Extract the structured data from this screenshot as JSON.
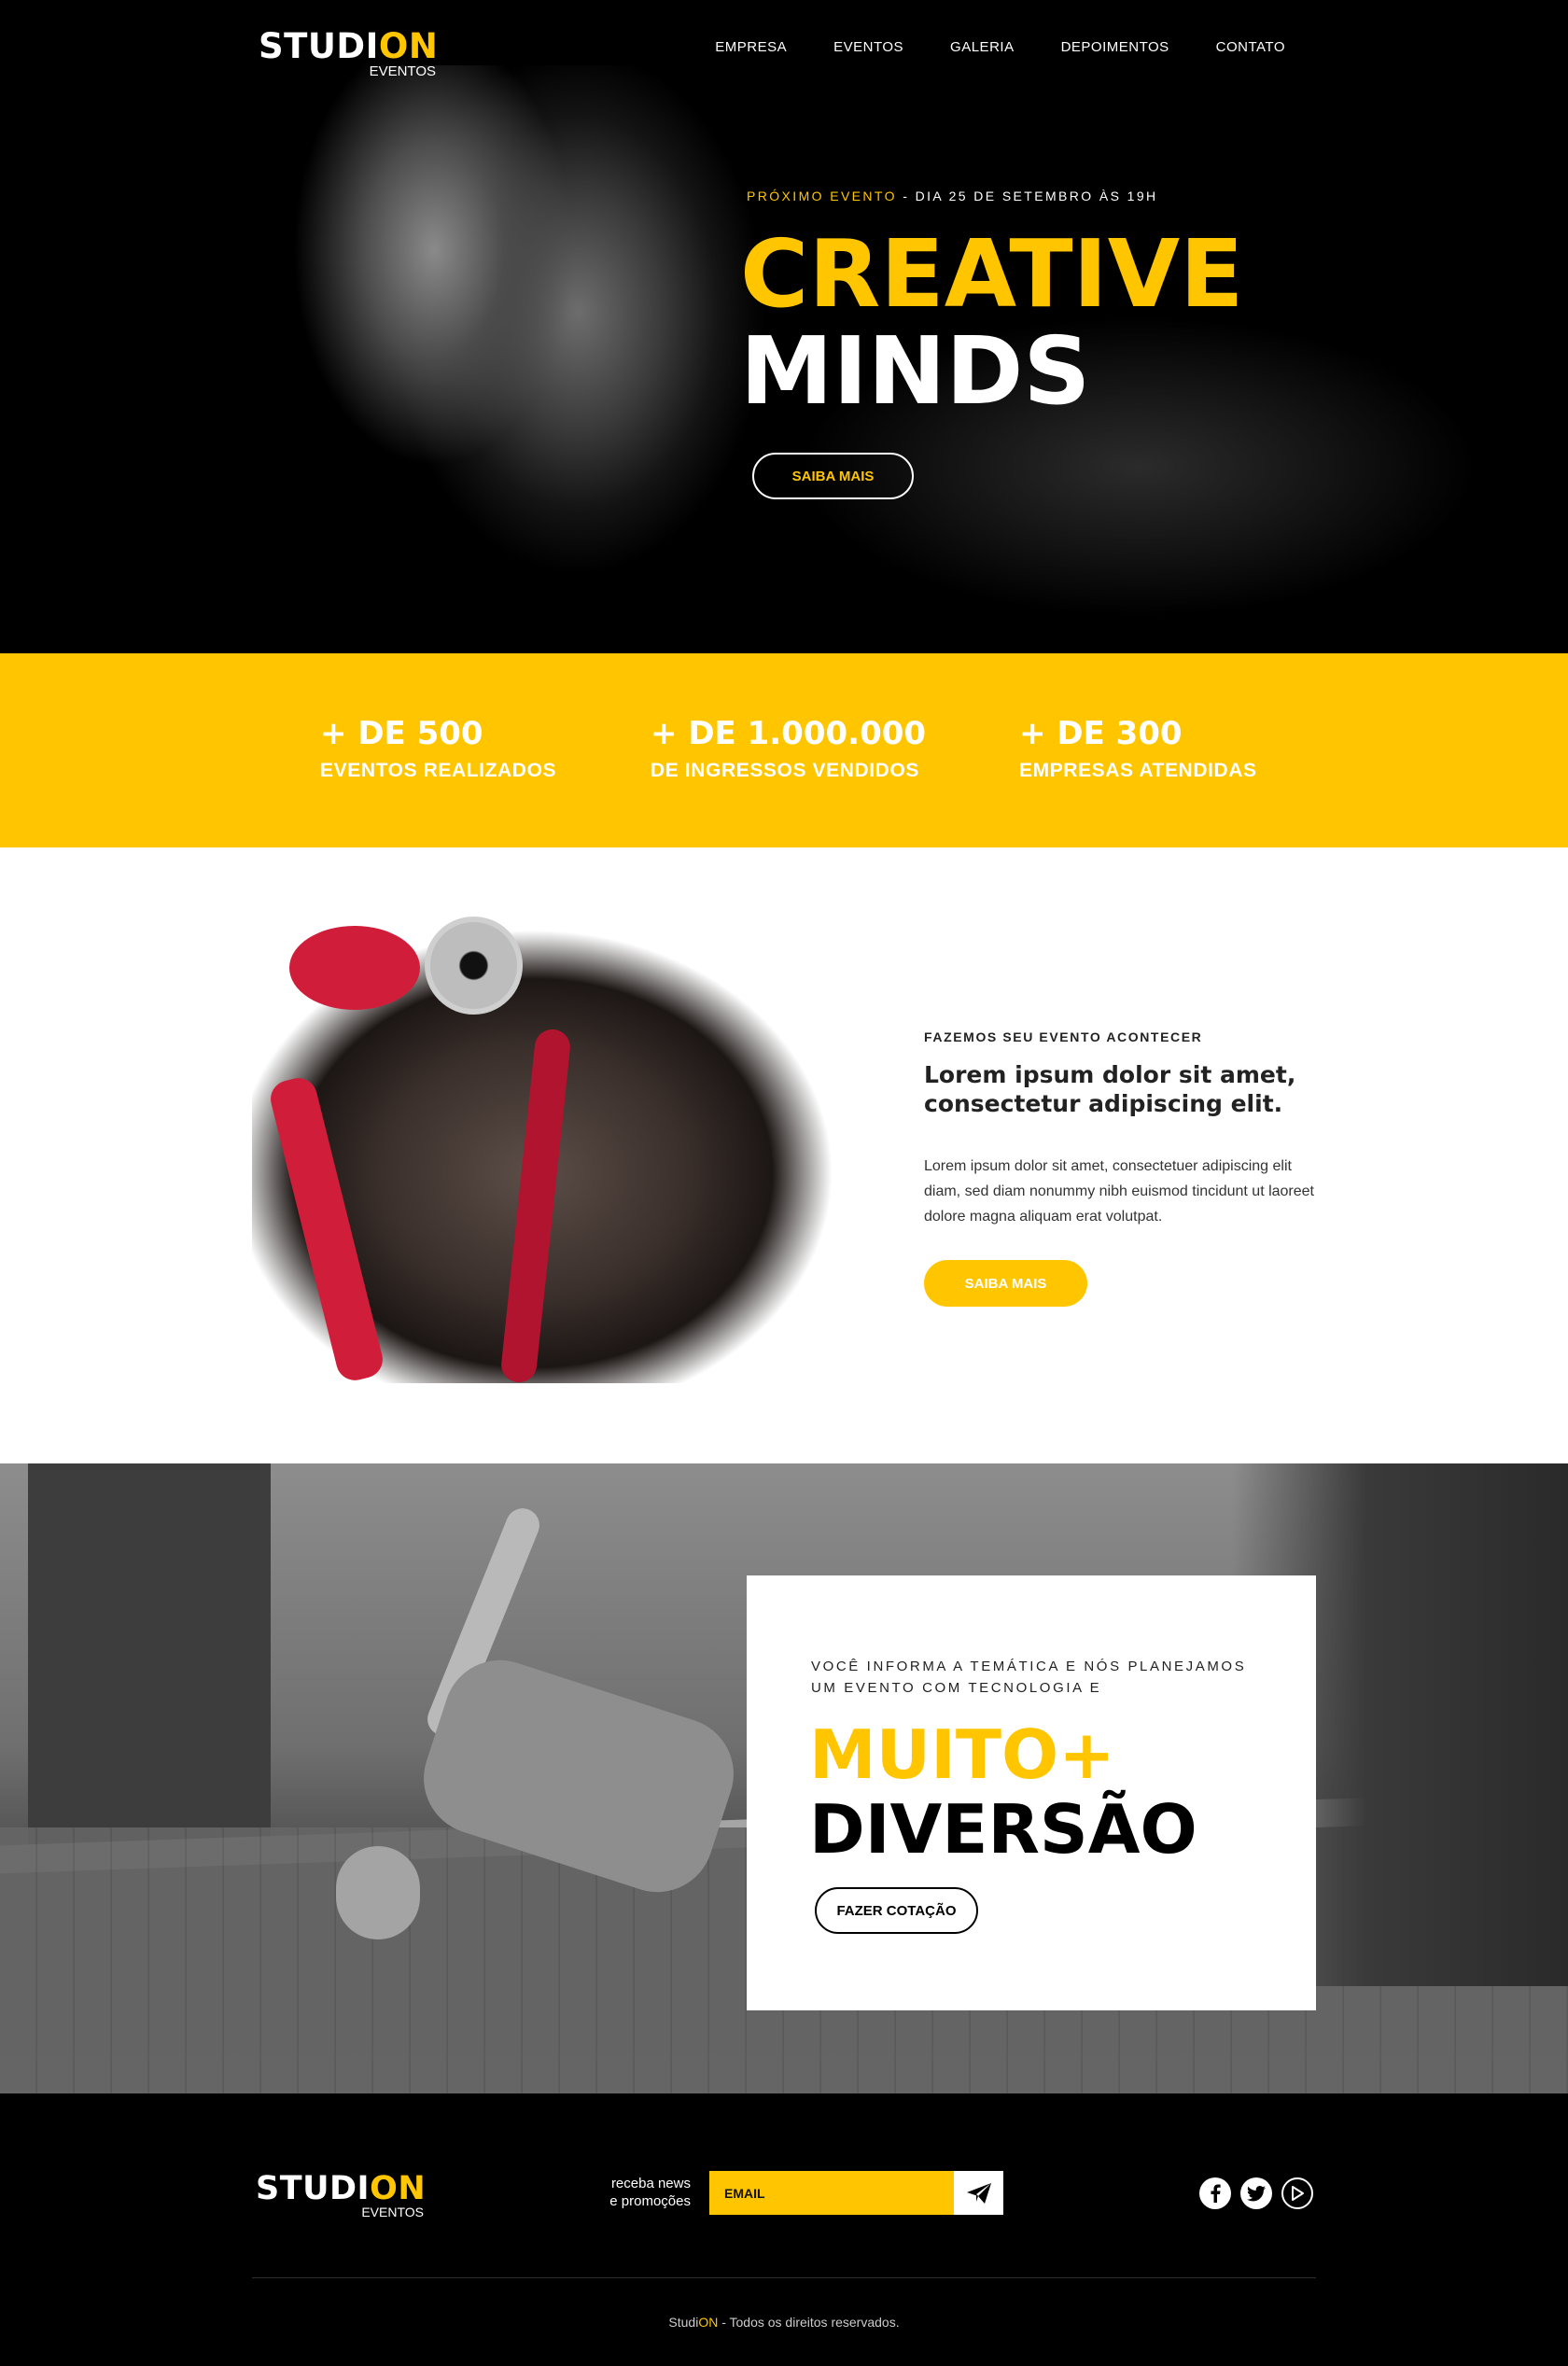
{
  "brand": {
    "logo_prefix": "STUDI",
    "logo_accent": "ON",
    "logo_sub": "EVENTOS"
  },
  "nav": {
    "items": [
      "EMPRESA",
      "EVENTOS",
      "GALERIA",
      "DEPOIMENTOS",
      "CONTATO"
    ]
  },
  "hero": {
    "next_event_label": "PRÓXIMO EVENTO",
    "next_event_date": " - DIA 25 DE SETEMBRO ÀS 19H",
    "title_line1": "CREATIVE",
    "title_line2": "MINDS",
    "button": "SAIBA MAIS"
  },
  "stats": [
    {
      "number": "+ DE 500",
      "label": "EVENTOS REALIZADOS"
    },
    {
      "number": "+ DE 1.000.000",
      "label": "DE INGRESSOS VENDIDOS"
    },
    {
      "number": "+ DE 300",
      "label": "EMPRESAS ATENDIDAS"
    }
  ],
  "about": {
    "kicker": "FAZEMOS SEU EVENTO ACONTECER",
    "title": "Lorem ipsum dolor sit amet, consectetur adipiscing elit.",
    "text": "Lorem ipsum dolor sit amet, consectetuer adipiscing elit diam, sed diam nonummy nibh euismod tincidunt ut laoreet dolore magna aliquam erat volutpat.",
    "button": "SAIBA MAIS"
  },
  "dance": {
    "kicker": "VOCÊ INFORMA A TEMÁTICA E NÓS PLANEJAMOS UM EVENTO COM TECNOLOGIA E",
    "title_line1": "MUITO+",
    "title_line2": "DIVERSÃO",
    "button": "FAZER COTAÇÃO"
  },
  "footer": {
    "news_label_line1": "receba news",
    "news_label_line2": "e promoções",
    "email_placeholder": "EMAIL",
    "copyright_brand_prefix": "Studi",
    "copyright_brand_accent": "ON",
    "copyright_text": " - Todos os direitos reservados."
  },
  "colors": {
    "accent": "#ffc600",
    "dark": "#000000",
    "light": "#ffffff"
  },
  "icons": [
    "send-icon",
    "facebook-icon",
    "twitter-icon",
    "youtube-icon"
  ]
}
